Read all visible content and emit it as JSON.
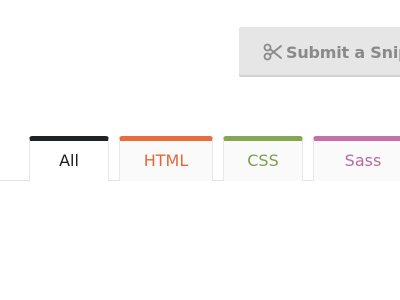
{
  "toolbar": {
    "submit_label": "Submit a Snippet",
    "submit_icon": "scissors-icon"
  },
  "tabs": [
    {
      "label": "All",
      "color": "#1f2227",
      "active": true
    },
    {
      "label": "HTML",
      "color": "#e86d3d",
      "active": false
    },
    {
      "label": "CSS",
      "color": "#86a652",
      "active": false
    },
    {
      "label": "Sass",
      "color": "#c670ab",
      "active": false
    }
  ]
}
